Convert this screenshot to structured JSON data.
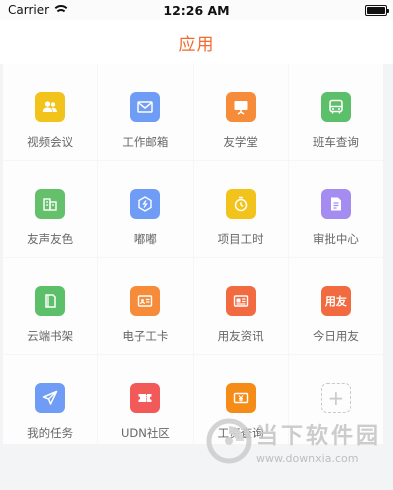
{
  "status_bar": {
    "carrier": "Carrier",
    "time": "12:26 AM",
    "battery_level": 1.0
  },
  "header": {
    "title": "应用"
  },
  "apps": [
    {
      "label": "视频会议",
      "icon": "video-meeting-icon",
      "color": "#f2c31a",
      "glyph": "people"
    },
    {
      "label": "工作邮箱",
      "icon": "mail-icon",
      "color": "#6f9cf5",
      "glyph": "mail"
    },
    {
      "label": "友学堂",
      "icon": "classroom-icon",
      "color": "#f68c39",
      "glyph": "board"
    },
    {
      "label": "班车查询",
      "icon": "bus-icon",
      "color": "#5cbf6a",
      "glyph": "bus"
    },
    {
      "label": "友声友色",
      "icon": "sound-icon",
      "color": "#65c06b",
      "glyph": "building"
    },
    {
      "label": "嘟嘟",
      "icon": "dudu-icon",
      "color": "#6f9cf5",
      "glyph": "hex"
    },
    {
      "label": "项目工时",
      "icon": "timer-icon",
      "color": "#f2c31a",
      "glyph": "timer"
    },
    {
      "label": "审批中心",
      "icon": "approval-icon",
      "color": "#a58cf0",
      "glyph": "doc"
    },
    {
      "label": "云端书架",
      "icon": "book-icon",
      "color": "#5cbf6a",
      "glyph": "book"
    },
    {
      "label": "电子工卡",
      "icon": "badge-card-icon",
      "color": "#f68c39",
      "glyph": "card"
    },
    {
      "label": "用友资讯",
      "icon": "news-icon",
      "color": "#f26a3f",
      "glyph": "news"
    },
    {
      "label": "今日用友",
      "icon": "yonyou-logo-icon",
      "color": "#f26a3f",
      "glyph": "text",
      "glyph_text": "用友"
    },
    {
      "label": "我的任务",
      "icon": "send-icon",
      "color": "#6f9cf5",
      "glyph": "send"
    },
    {
      "label": "UDN社区",
      "icon": "ticket-icon",
      "color": "#f25a5a",
      "glyph": "ticket"
    },
    {
      "label": "工资查询",
      "icon": "salary-icon",
      "color": "#f68c18",
      "glyph": "money"
    },
    {
      "label": "",
      "icon": "add-icon",
      "color": "#c9c9c9",
      "glyph": "plus"
    }
  ],
  "watermark": {
    "title": "当下软件园",
    "url": "www.downxia.com"
  }
}
